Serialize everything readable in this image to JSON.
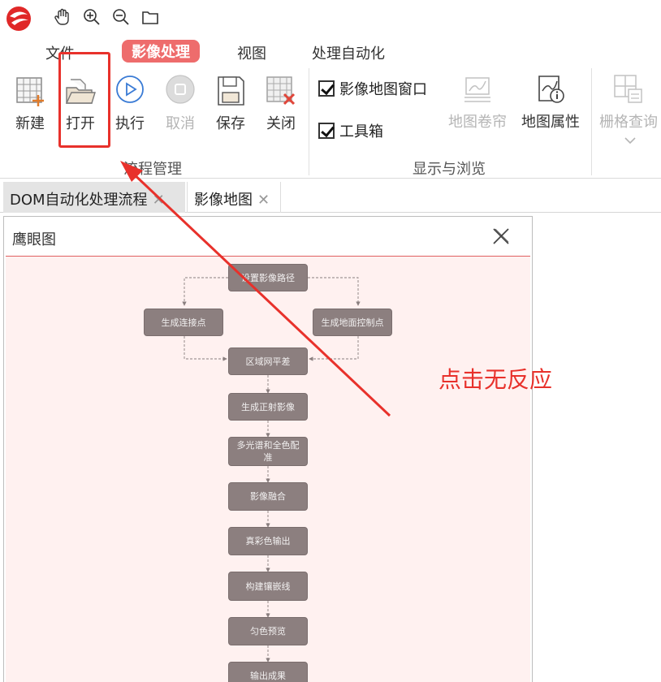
{
  "menu": {
    "items": [
      "文件",
      "影像处理",
      "视图",
      "处理自动化"
    ]
  },
  "ribbon": {
    "workflow_buttons": [
      "新建",
      "打开",
      "执行",
      "取消",
      "保存",
      "关闭"
    ],
    "workflow_group": "流程管理",
    "checkboxes": [
      "影像地图窗口",
      "工具箱"
    ],
    "display_buttons": [
      "地图卷帘",
      "地图属性"
    ],
    "display_group": "显示与浏览",
    "raster_query": "栅格查询"
  },
  "tabs": [
    "DOM自动化处理流程",
    "影像地图"
  ],
  "panel": {
    "title": "鹰眼图"
  },
  "flow": {
    "nodes": [
      "设置影像路径",
      "生成连接点",
      "生成地面控制点",
      "区域网平差",
      "生成正射影像",
      "多光谱和全色配准",
      "影像融合",
      "真彩色输出",
      "构建镶嵌线",
      "匀色预览",
      "输出成果"
    ]
  },
  "annotation": {
    "text": "点击无反应"
  },
  "colors": {
    "active_tab": "#ee6c6c",
    "highlight_box": "#e8312b",
    "flow_node": "#8c7f7f",
    "panel_bg": "#fff1f0"
  }
}
